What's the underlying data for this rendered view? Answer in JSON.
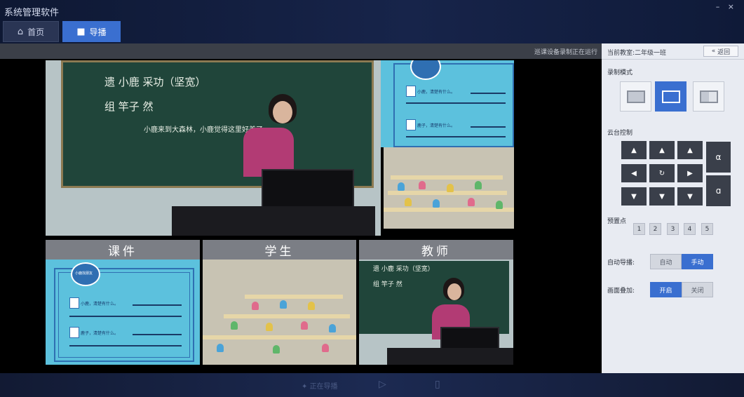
{
  "app": {
    "title": "系统管理软件",
    "window_controls": "– ×"
  },
  "tabs": [
    {
      "label": "首页",
      "icon": "home-icon"
    },
    {
      "label": "导播",
      "icon": "camera-icon"
    }
  ],
  "status": {
    "text": "巡课设备录制正在运行"
  },
  "stage": {
    "blackboard_lines": [
      "遗  小鹿  采功（坚宽）",
      "组  竿子  然"
    ],
    "blackboard_sentence": "小鹿来到大森林，小鹿觉得这里好美了。",
    "courseware_q1": "小鹿，清楚有什么。",
    "courseware_q2": "鹿子，清楚有什么。",
    "badge_text": "小鹿找朋友",
    "labels": {
      "courseware": "课件",
      "students": "学生",
      "teacher": "教师"
    }
  },
  "panel": {
    "title": "当前教室:二年级一班",
    "back_button": "返回",
    "record_mode_label": "录制模式",
    "ptz_label": "云台控制",
    "ptz_buttons": [
      "▲",
      "▲",
      "▲",
      "◀",
      "↻",
      "▶",
      "▼",
      "▼",
      "▼"
    ],
    "zoom_in": "α",
    "zoom_out": "ɑ",
    "preset_label": "预置点",
    "presets": [
      "1",
      "2",
      "3",
      "4",
      "5"
    ],
    "auto_switch_label": "自动导播:",
    "auto_options": {
      "auto": "自动",
      "manual": "手动"
    },
    "overlay_label": "画面叠加:",
    "overlay_options": {
      "on": "开启",
      "off": "关闭"
    }
  },
  "bottom": {
    "label": "正在导播"
  },
  "colors": {
    "accent": "#3a6fd0",
    "panel_bg": "#e8ebf2",
    "title_bar": "#17244a"
  }
}
